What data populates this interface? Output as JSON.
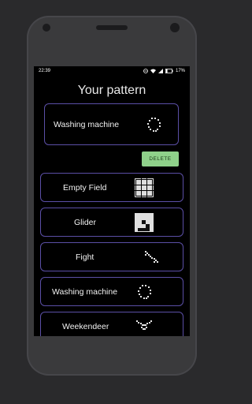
{
  "status_bar": {
    "time": "22:39",
    "battery": "17%"
  },
  "screen_title": "Your pattern",
  "selected": {
    "label": "Washing machine",
    "icon": "washing-machine-pattern-icon"
  },
  "delete_label": "DELETE",
  "patterns": [
    {
      "label": "Empty Field",
      "icon": "grid-icon"
    },
    {
      "label": "Glider",
      "icon": "glider-pattern-icon"
    },
    {
      "label": "Fight",
      "icon": "fight-pattern-icon"
    },
    {
      "label": "Washing machine",
      "icon": "washing-machine-pattern-icon"
    },
    {
      "label": "Weekendeer",
      "icon": "weekendeer-pattern-icon"
    }
  ],
  "colors": {
    "card_border": "#5b4fa6",
    "delete_bg": "#8fd18a",
    "screen_bg": "#000000"
  }
}
